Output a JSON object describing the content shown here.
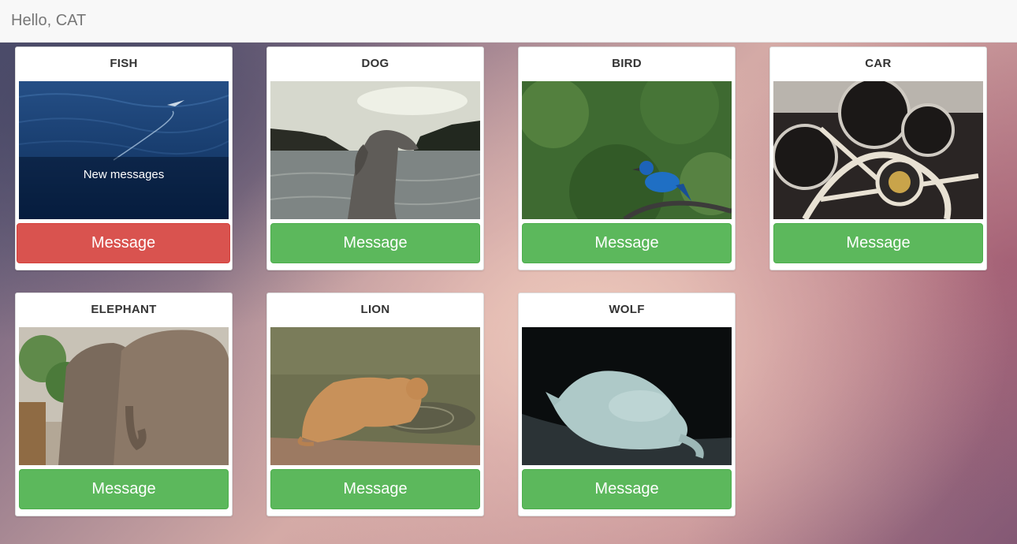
{
  "navbar": {
    "greeting": "Hello, CAT"
  },
  "cards": [
    {
      "title": "FISH",
      "button_label": "Message",
      "status": "New messages",
      "button_color": "#d9534f"
    },
    {
      "title": "DOG",
      "button_label": "Message",
      "button_color": "#5cb85c"
    },
    {
      "title": "BIRD",
      "button_label": "Message",
      "button_color": "#5cb85c"
    },
    {
      "title": "CAR",
      "button_label": "Message",
      "button_color": "#5cb85c"
    },
    {
      "title": "ELEPHANT",
      "button_label": "Message",
      "button_color": "#5cb85c"
    },
    {
      "title": "LION",
      "button_label": "Message",
      "button_color": "#5cb85c"
    },
    {
      "title": "WOLF",
      "button_label": "Message",
      "button_color": "#5cb85c"
    }
  ]
}
